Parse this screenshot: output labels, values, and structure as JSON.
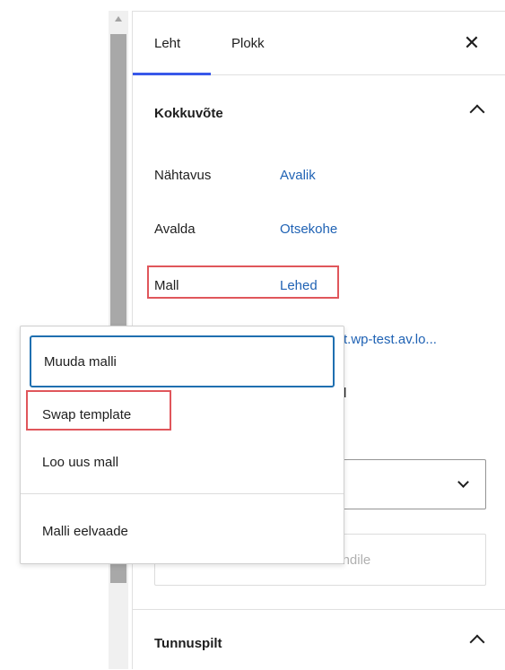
{
  "tabs": {
    "page": "Leht",
    "block": "Plokk",
    "close": "✕"
  },
  "summary": {
    "title": "Kokkuvõte",
    "rows": [
      {
        "label": "Nähtavus",
        "value": "Avalik"
      },
      {
        "label": "Avalda",
        "value": "Otsekohe"
      },
      {
        "label": "Mall",
        "value": "Lehed"
      }
    ],
    "url_partial": "t.wp-test.av.lo...",
    "partial_letter": "l",
    "draft_button": "Lülita mustandile"
  },
  "featured_image": {
    "title": "Tunnuspilt"
  },
  "template_menu": {
    "items": [
      "Muuda malli",
      "Swap template",
      "Loo uus mall"
    ],
    "preview": "Malli eelvaade"
  },
  "colors": {
    "accent": "#3858e9",
    "link": "#1f62b4",
    "highlight": "#e0565b",
    "focus": "#1f6fb0"
  }
}
